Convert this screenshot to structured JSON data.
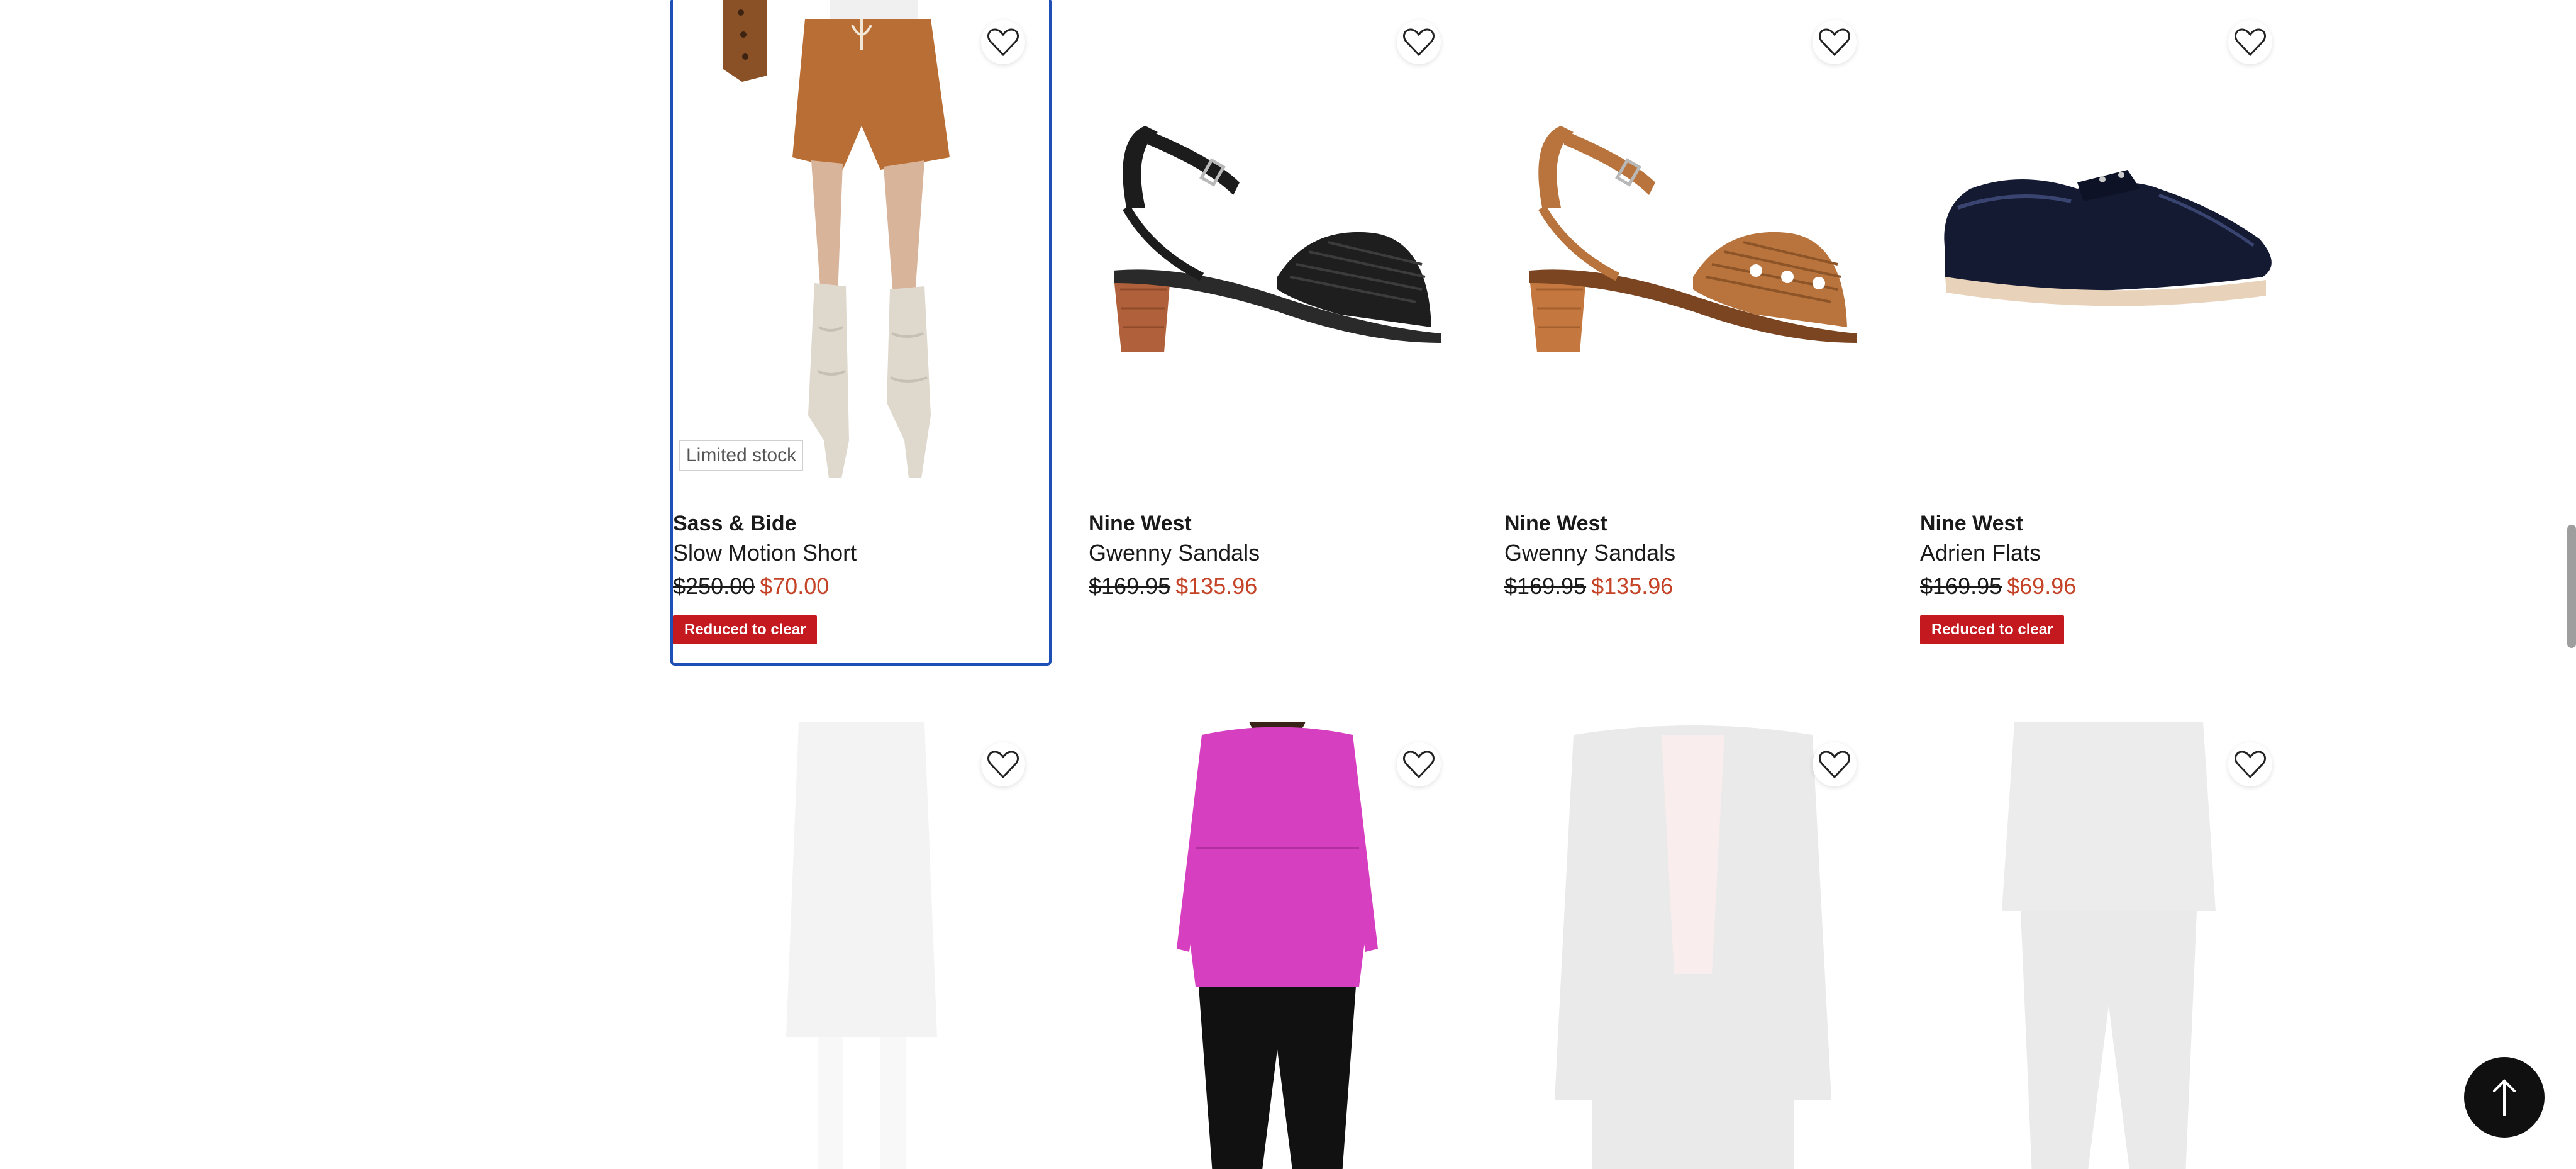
{
  "products": [
    {
      "brand": "Sass & Bide",
      "name": "Slow Motion Short",
      "was_price": "$250.00",
      "now_price": "$70.00",
      "badge": "Limited stock",
      "promo": "Reduced to clear",
      "image": "model wearing brown shorts and slouch boots"
    },
    {
      "brand": "Nine West",
      "name": "Gwenny Sandals",
      "was_price": "$169.95",
      "now_price": "$135.96",
      "image": "black woven block heel sandal"
    },
    {
      "brand": "Nine West",
      "name": "Gwenny Sandals",
      "was_price": "$169.95",
      "now_price": "$135.96",
      "image": "tan woven block heel sandal"
    },
    {
      "brand": "Nine West",
      "name": "Adrien Flats",
      "was_price": "$169.95",
      "now_price": "$69.96",
      "promo": "Reduced to clear",
      "image": "navy patent lace-up brogue flat"
    }
  ],
  "row2_images": [
    "faded dress image",
    "model in pink knit top and black pants",
    "faded black jacket image",
    "faded black outfit image"
  ],
  "icons": {
    "favorite": "heart-icon",
    "scroll_top": "arrow-up-icon"
  },
  "colors": {
    "sale_price": "#c44326",
    "promo_bg": "#c4191f",
    "focus_outline": "#1d4fb4"
  }
}
